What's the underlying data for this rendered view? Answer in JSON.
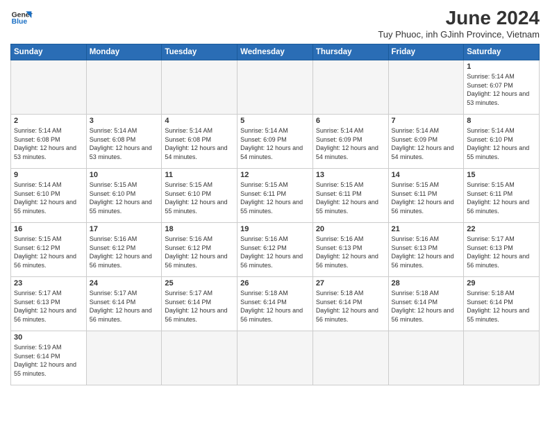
{
  "logo": {
    "line1": "General",
    "line2": "Blue"
  },
  "title": "June 2024",
  "subtitle": "Tuy Phuoc, inh GJinh Province, Vietnam",
  "days_of_week": [
    "Sunday",
    "Monday",
    "Tuesday",
    "Wednesday",
    "Thursday",
    "Friday",
    "Saturday"
  ],
  "weeks": [
    [
      {
        "day": "",
        "info": ""
      },
      {
        "day": "",
        "info": ""
      },
      {
        "day": "",
        "info": ""
      },
      {
        "day": "",
        "info": ""
      },
      {
        "day": "",
        "info": ""
      },
      {
        "day": "",
        "info": ""
      },
      {
        "day": "1",
        "info": "Sunrise: 5:14 AM\nSunset: 6:07 PM\nDaylight: 12 hours and 53 minutes."
      }
    ],
    [
      {
        "day": "2",
        "info": "Sunrise: 5:14 AM\nSunset: 6:08 PM\nDaylight: 12 hours and 53 minutes."
      },
      {
        "day": "3",
        "info": "Sunrise: 5:14 AM\nSunset: 6:08 PM\nDaylight: 12 hours and 53 minutes."
      },
      {
        "day": "4",
        "info": "Sunrise: 5:14 AM\nSunset: 6:08 PM\nDaylight: 12 hours and 54 minutes."
      },
      {
        "day": "5",
        "info": "Sunrise: 5:14 AM\nSunset: 6:09 PM\nDaylight: 12 hours and 54 minutes."
      },
      {
        "day": "6",
        "info": "Sunrise: 5:14 AM\nSunset: 6:09 PM\nDaylight: 12 hours and 54 minutes."
      },
      {
        "day": "7",
        "info": "Sunrise: 5:14 AM\nSunset: 6:09 PM\nDaylight: 12 hours and 54 minutes."
      },
      {
        "day": "8",
        "info": "Sunrise: 5:14 AM\nSunset: 6:10 PM\nDaylight: 12 hours and 55 minutes."
      }
    ],
    [
      {
        "day": "9",
        "info": "Sunrise: 5:14 AM\nSunset: 6:10 PM\nDaylight: 12 hours and 55 minutes."
      },
      {
        "day": "10",
        "info": "Sunrise: 5:15 AM\nSunset: 6:10 PM\nDaylight: 12 hours and 55 minutes."
      },
      {
        "day": "11",
        "info": "Sunrise: 5:15 AM\nSunset: 6:10 PM\nDaylight: 12 hours and 55 minutes."
      },
      {
        "day": "12",
        "info": "Sunrise: 5:15 AM\nSunset: 6:11 PM\nDaylight: 12 hours and 55 minutes."
      },
      {
        "day": "13",
        "info": "Sunrise: 5:15 AM\nSunset: 6:11 PM\nDaylight: 12 hours and 55 minutes."
      },
      {
        "day": "14",
        "info": "Sunrise: 5:15 AM\nSunset: 6:11 PM\nDaylight: 12 hours and 56 minutes."
      },
      {
        "day": "15",
        "info": "Sunrise: 5:15 AM\nSunset: 6:11 PM\nDaylight: 12 hours and 56 minutes."
      }
    ],
    [
      {
        "day": "16",
        "info": "Sunrise: 5:15 AM\nSunset: 6:12 PM\nDaylight: 12 hours and 56 minutes."
      },
      {
        "day": "17",
        "info": "Sunrise: 5:16 AM\nSunset: 6:12 PM\nDaylight: 12 hours and 56 minutes."
      },
      {
        "day": "18",
        "info": "Sunrise: 5:16 AM\nSunset: 6:12 PM\nDaylight: 12 hours and 56 minutes."
      },
      {
        "day": "19",
        "info": "Sunrise: 5:16 AM\nSunset: 6:12 PM\nDaylight: 12 hours and 56 minutes."
      },
      {
        "day": "20",
        "info": "Sunrise: 5:16 AM\nSunset: 6:13 PM\nDaylight: 12 hours and 56 minutes."
      },
      {
        "day": "21",
        "info": "Sunrise: 5:16 AM\nSunset: 6:13 PM\nDaylight: 12 hours and 56 minutes."
      },
      {
        "day": "22",
        "info": "Sunrise: 5:17 AM\nSunset: 6:13 PM\nDaylight: 12 hours and 56 minutes."
      }
    ],
    [
      {
        "day": "23",
        "info": "Sunrise: 5:17 AM\nSunset: 6:13 PM\nDaylight: 12 hours and 56 minutes."
      },
      {
        "day": "24",
        "info": "Sunrise: 5:17 AM\nSunset: 6:14 PM\nDaylight: 12 hours and 56 minutes."
      },
      {
        "day": "25",
        "info": "Sunrise: 5:17 AM\nSunset: 6:14 PM\nDaylight: 12 hours and 56 minutes."
      },
      {
        "day": "26",
        "info": "Sunrise: 5:18 AM\nSunset: 6:14 PM\nDaylight: 12 hours and 56 minutes."
      },
      {
        "day": "27",
        "info": "Sunrise: 5:18 AM\nSunset: 6:14 PM\nDaylight: 12 hours and 56 minutes."
      },
      {
        "day": "28",
        "info": "Sunrise: 5:18 AM\nSunset: 6:14 PM\nDaylight: 12 hours and 56 minutes."
      },
      {
        "day": "29",
        "info": "Sunrise: 5:18 AM\nSunset: 6:14 PM\nDaylight: 12 hours and 55 minutes."
      }
    ],
    [
      {
        "day": "30",
        "info": "Sunrise: 5:19 AM\nSunset: 6:14 PM\nDaylight: 12 hours and 55 minutes."
      },
      {
        "day": "",
        "info": ""
      },
      {
        "day": "",
        "info": ""
      },
      {
        "day": "",
        "info": ""
      },
      {
        "day": "",
        "info": ""
      },
      {
        "day": "",
        "info": ""
      },
      {
        "day": "",
        "info": ""
      }
    ]
  ]
}
